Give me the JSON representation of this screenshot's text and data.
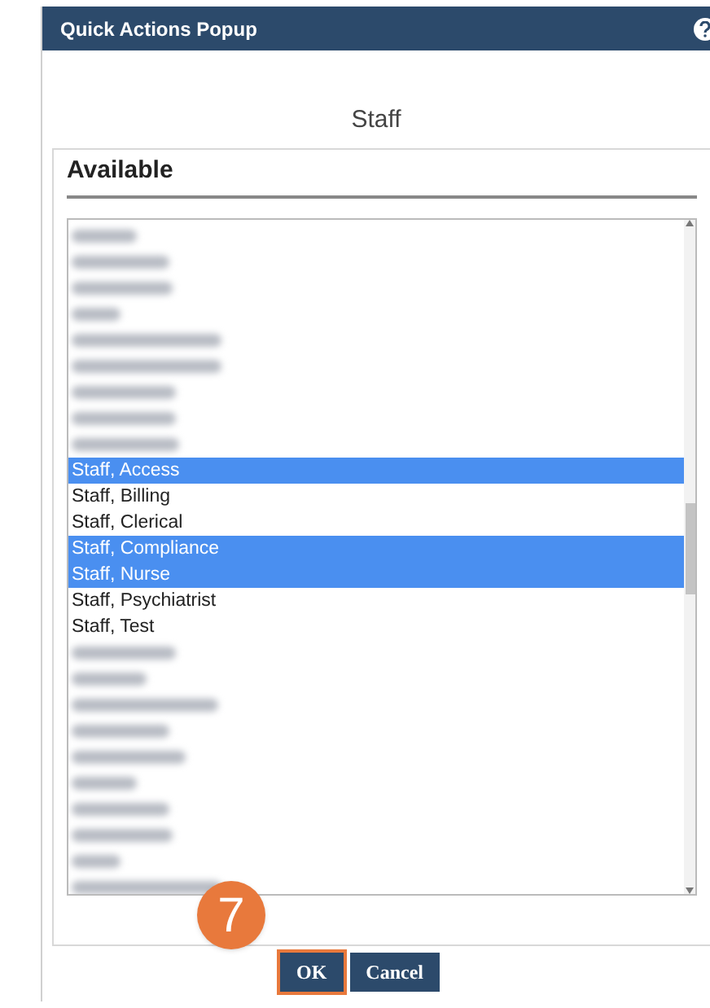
{
  "window": {
    "title": "Quick Actions Popup"
  },
  "heading": "Staff",
  "panel": {
    "title": "Available",
    "items": [
      {
        "kind": "redacted",
        "selected": false
      },
      {
        "kind": "redacted",
        "selected": false
      },
      {
        "kind": "redacted",
        "selected": false
      },
      {
        "kind": "redacted",
        "selected": false
      },
      {
        "kind": "redacted",
        "selected": false
      },
      {
        "kind": "redacted",
        "selected": false
      },
      {
        "kind": "redacted",
        "selected": false
      },
      {
        "kind": "redacted",
        "selected": false
      },
      {
        "kind": "redacted",
        "selected": false
      },
      {
        "kind": "name",
        "label": "Staff, Access",
        "selected": true
      },
      {
        "kind": "name",
        "label": "Staff, Billing",
        "selected": false
      },
      {
        "kind": "name",
        "label": "Staff, Clerical",
        "selected": false
      },
      {
        "kind": "name",
        "label": "Staff, Compliance",
        "selected": true
      },
      {
        "kind": "name",
        "label": "Staff, Nurse",
        "selected": true
      },
      {
        "kind": "name",
        "label": "Staff, Psychiatrist",
        "selected": false
      },
      {
        "kind": "name",
        "label": "Staff, Test",
        "selected": false
      },
      {
        "kind": "redacted",
        "selected": false
      },
      {
        "kind": "redacted",
        "selected": false
      },
      {
        "kind": "redacted",
        "selected": false
      },
      {
        "kind": "redacted",
        "selected": false
      },
      {
        "kind": "redacted",
        "selected": false
      },
      {
        "kind": "redacted",
        "selected": false
      },
      {
        "kind": "redacted",
        "selected": false
      },
      {
        "kind": "redacted",
        "selected": false
      },
      {
        "kind": "redacted",
        "selected": false
      },
      {
        "kind": "redacted",
        "selected": false
      }
    ]
  },
  "step_badge": "7",
  "buttons": [
    {
      "label": "OK",
      "focused": true
    },
    {
      "label": "Cancel",
      "focused": false
    }
  ]
}
